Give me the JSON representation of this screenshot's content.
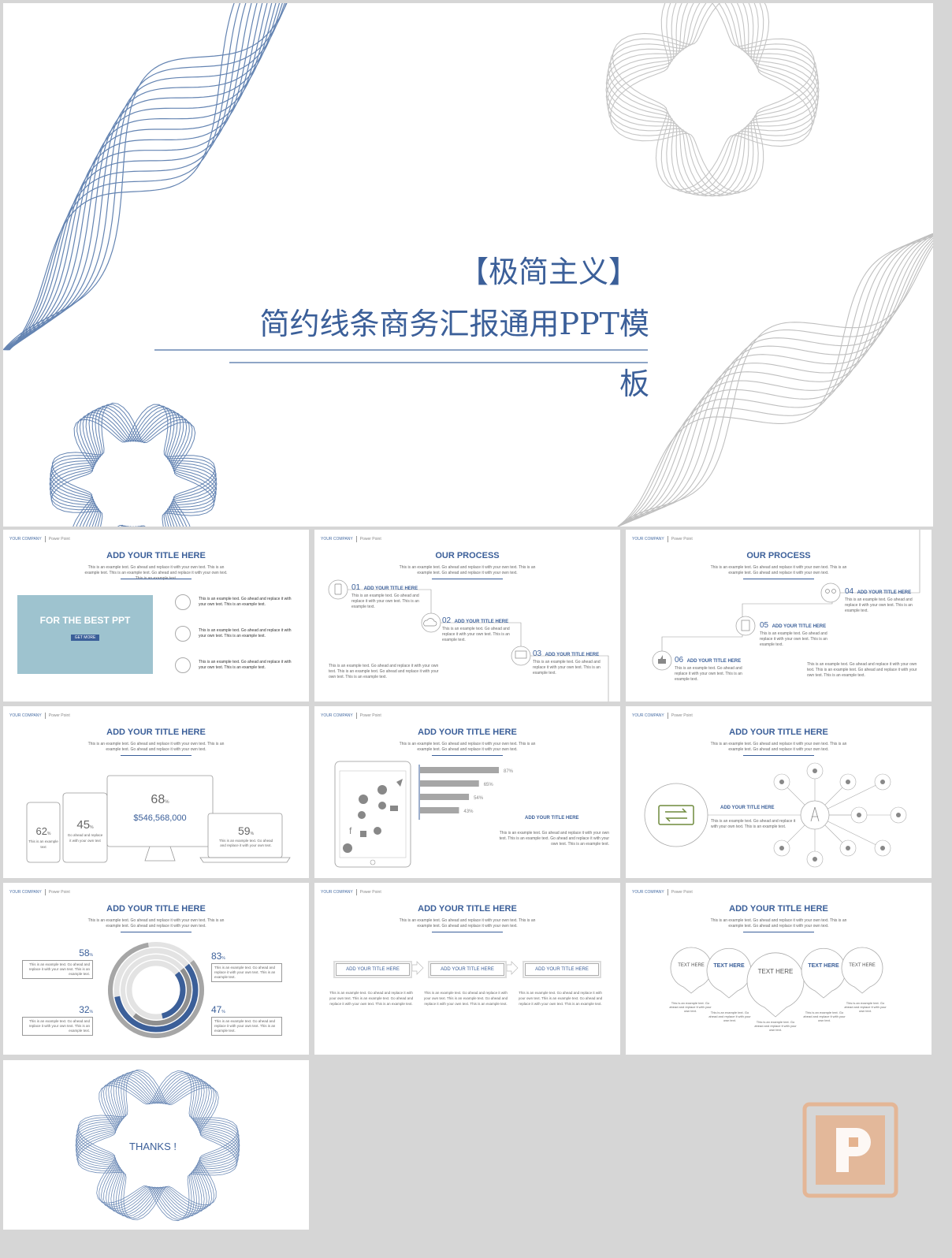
{
  "cover": {
    "bracket_title": "【极简主义】",
    "main_title_line1": "简约线条商务汇报通用PPT模",
    "main_title_line2": "板"
  },
  "common": {
    "company": "YOUR COMPANY",
    "power_point": "Power Point",
    "subtitle": "This is an example text. Go ahead and replace it with your own text. This is an example text. Go ahead and replace it with your own text.",
    "subtitle_s1": "This is an example text. Go ahead and replace it with your own text. This is an example text. This is an example text. Go ahead and replace it with your own text. This is an example text.",
    "example_short": "This is an example text. Go ahead and replace it with your own text. This is an example text.",
    "example_long": "This is an example text. Go ahead and replace it with your own text. This is an example text. Go ahead and replace it with your own text. This is an example text.",
    "example_para": "This is an example text. Go ahead and replace it with your own text. This is an example text. Go ahead and replace it with your own text. This is an example text.",
    "example_step": "This is an example text. Go ahead and replace it with your own text. This is an example text.",
    "example_item": "This is an example text. Go ahead and replace it with your own text. This is an example text."
  },
  "s1": {
    "title": "ADD YOUR TITLE HERE",
    "box_title": "FOR THE BEST PPT",
    "box_button": "GET MORE",
    "items": [
      "This is an example text. Go ahead and replace it with your own text. This is an example text.",
      "This is an example text. Go ahead and replace it with your own text. This is an example text.",
      "This is an example text. Go ahead and replace it with your own text. This is an example text."
    ]
  },
  "s2": {
    "title": "OUR PROCESS",
    "steps": [
      {
        "num": "01",
        "label": "ADD YOUR TITLE HERE"
      },
      {
        "num": "02",
        "label": "ADD YOUR TITLE HERE"
      },
      {
        "num": "03",
        "label": "ADD YOUR TITLE HERE"
      }
    ]
  },
  "s3": {
    "title": "OUR PROCESS",
    "steps": [
      {
        "num": "04",
        "label": "ADD YOUR TITLE HERE"
      },
      {
        "num": "05",
        "label": "ADD YOUR TITLE HERE"
      },
      {
        "num": "06",
        "label": "ADD YOUR TITLE HERE"
      }
    ]
  },
  "s4": {
    "title": "ADD YOUR TITLE HERE",
    "phone_pct": "62",
    "phone_text": "This is an example text",
    "tablet_pct": "45",
    "tablet_text": "Go ahead and replace it with your own text",
    "monitor_pct": "68",
    "monitor_amount": "$546,568,000",
    "laptop_pct": "59",
    "laptop_text": "This is an example text. Go ahead and replace it with your own text.",
    "pct_sign": "%"
  },
  "s5": {
    "title": "ADD YOUR TITLE HERE",
    "bars": [
      {
        "value": 87,
        "label": "87%"
      },
      {
        "value": 65,
        "label": "65%"
      },
      {
        "value": 54,
        "label": "54%"
      },
      {
        "value": 43,
        "label": "43%"
      }
    ],
    "side_title": "ADD YOUR TITLE HERE"
  },
  "s6": {
    "title": "ADD YOUR TITLE HERE",
    "side_title": "ADD YOUR TITLE HERE"
  },
  "s7": {
    "title": "ADD YOUR TITLE HERE",
    "items": [
      {
        "pct": "58",
        "pos": "tl"
      },
      {
        "pct": "83",
        "pos": "tr"
      },
      {
        "pct": "32",
        "pos": "bl"
      },
      {
        "pct": "47",
        "pos": "br"
      }
    ],
    "ring_values": [
      0.83,
      0.58,
      0.47,
      0.32
    ]
  },
  "s8": {
    "title": "ADD YOUR TITLE HERE",
    "boxes": [
      "ADD YOUR TITLE HERE",
      "ADD YOUR TITLE HERE",
      "ADD YOUR TITLE HERE"
    ]
  },
  "s9": {
    "title": "ADD YOUR TITLE HERE",
    "pins": [
      "TEXT HERE",
      "TEXT HERE",
      "TEXT HERE",
      "TEXT HERE",
      "TEXT HERE"
    ],
    "pin_text": "This is an example text. Go ahead and replace it with your own text."
  },
  "thanks": {
    "label": "THANKS !"
  },
  "colors": {
    "accent": "#3b5f99",
    "line_blue": "#4a6fa5",
    "line_gray": "#b8b8b8",
    "box_blue": "#9ec3cf",
    "watermark": "#e5b38f"
  }
}
